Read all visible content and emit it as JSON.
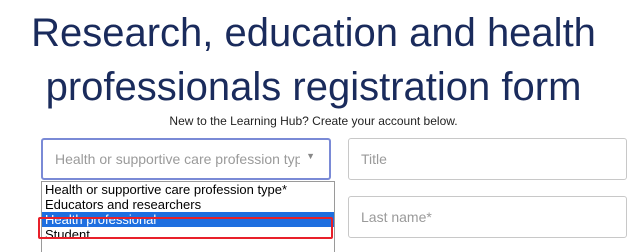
{
  "page": {
    "title_line1": "Research, education and health",
    "title_line2": "professionals registration form",
    "subtitle": "New to the Learning Hub? Create your account below."
  },
  "form": {
    "profession_select": {
      "value": "Health or supportive care profession type*",
      "options": [
        "Health or supportive care profession type*",
        "Educators and researchers",
        "Health professional",
        "Student"
      ],
      "highlighted_index": 2
    },
    "title_field": {
      "placeholder": "Title"
    },
    "last_name_field": {
      "placeholder": "Last name*"
    }
  },
  "colors": {
    "title": "#1a2b5c",
    "select_border": "#7a8ad6",
    "option_highlight": "#1e6fe0",
    "annotation_frame": "#e8202a"
  },
  "icons": {
    "select_chevron": "chevron-down-icon"
  }
}
